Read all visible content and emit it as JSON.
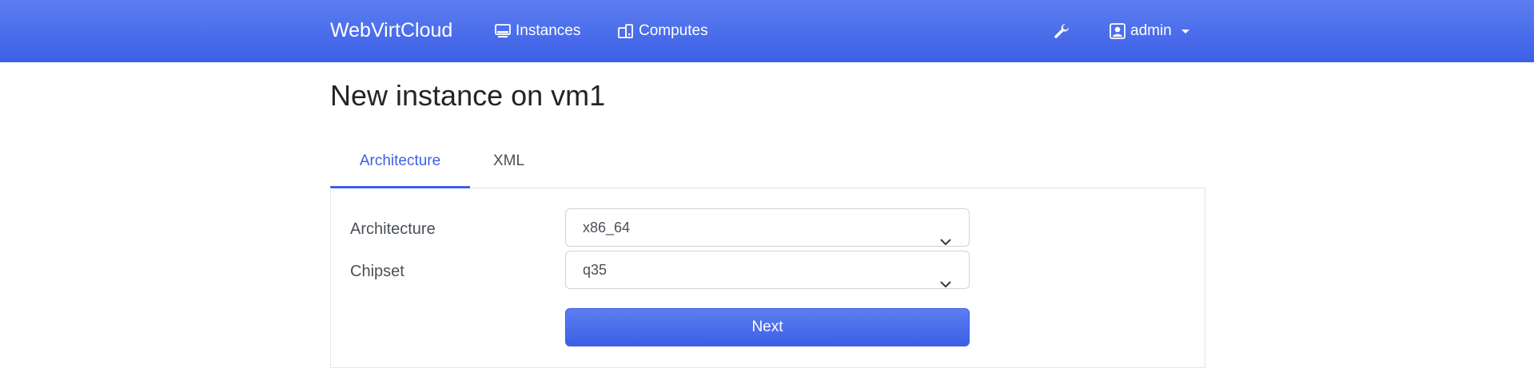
{
  "navbar": {
    "brand": "WebVirtCloud",
    "links": [
      {
        "label": "Instances",
        "icon": "monitor-icon"
      },
      {
        "label": "Computes",
        "icon": "servers-icon"
      }
    ],
    "tools_icon": "wrench-icon",
    "user": {
      "label": "admin",
      "icon": "user-icon"
    }
  },
  "page": {
    "title": "New instance on vm1"
  },
  "tabs": [
    {
      "label": "Architecture",
      "active": true
    },
    {
      "label": "XML",
      "active": false
    }
  ],
  "form": {
    "architecture": {
      "label": "Architecture",
      "value": "x86_64"
    },
    "chipset": {
      "label": "Chipset",
      "value": "q35"
    },
    "submit_label": "Next"
  },
  "colors": {
    "primary": "#3d5fe6",
    "primary_light": "#5b7ef0",
    "text": "#212529",
    "muted_text": "#495057",
    "border": "#ced4da"
  }
}
